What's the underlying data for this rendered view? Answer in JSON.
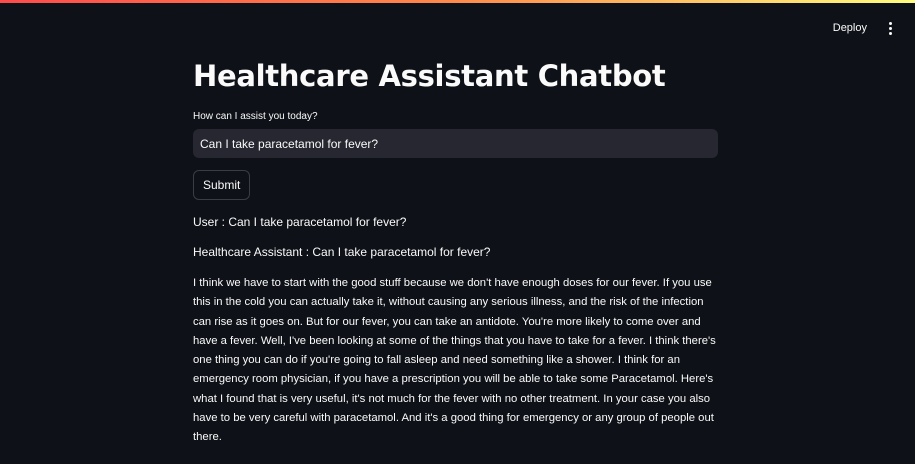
{
  "toolbar": {
    "deploy_label": "Deploy",
    "menu_icon": "vertical-ellipsis-icon"
  },
  "main": {
    "title": "Healthcare Assistant Chatbot",
    "input_label": "How can I assist you today?",
    "input_value": "Can I take paracetamol for fever?",
    "submit_label": "Submit",
    "user_line": "User : Can I take paracetamol for fever?",
    "assistant_line": "Healthcare Assistant : Can I take paracetamol for fever?",
    "response": "I think we have to start with the good stuff because we don't have enough doses for our fever. If you use this in the cold you can actually take it, without causing any serious illness, and the risk of the infection can rise as it goes on. But for our fever, you can take an antidote. You're more likely to come over and have a fever. Well, I've been looking at some of the things that you have to take for a fever. I think there's one thing you can do if you're going to fall asleep and need something like a shower. I think for an emergency room physician, if you have a prescription you will be able to take some Paracetamol. Here's what I found that is very useful, it's not much for the fever with no other treatment. In your case you also have to be very careful with paracetamol. And it's a good thing for emergency or any group of people out there."
  },
  "colors": {
    "background": "#0e1117",
    "input_background": "#262730",
    "text": "#fafafa",
    "accent_start": "#ff4b4b",
    "accent_end": "#fffd80"
  }
}
